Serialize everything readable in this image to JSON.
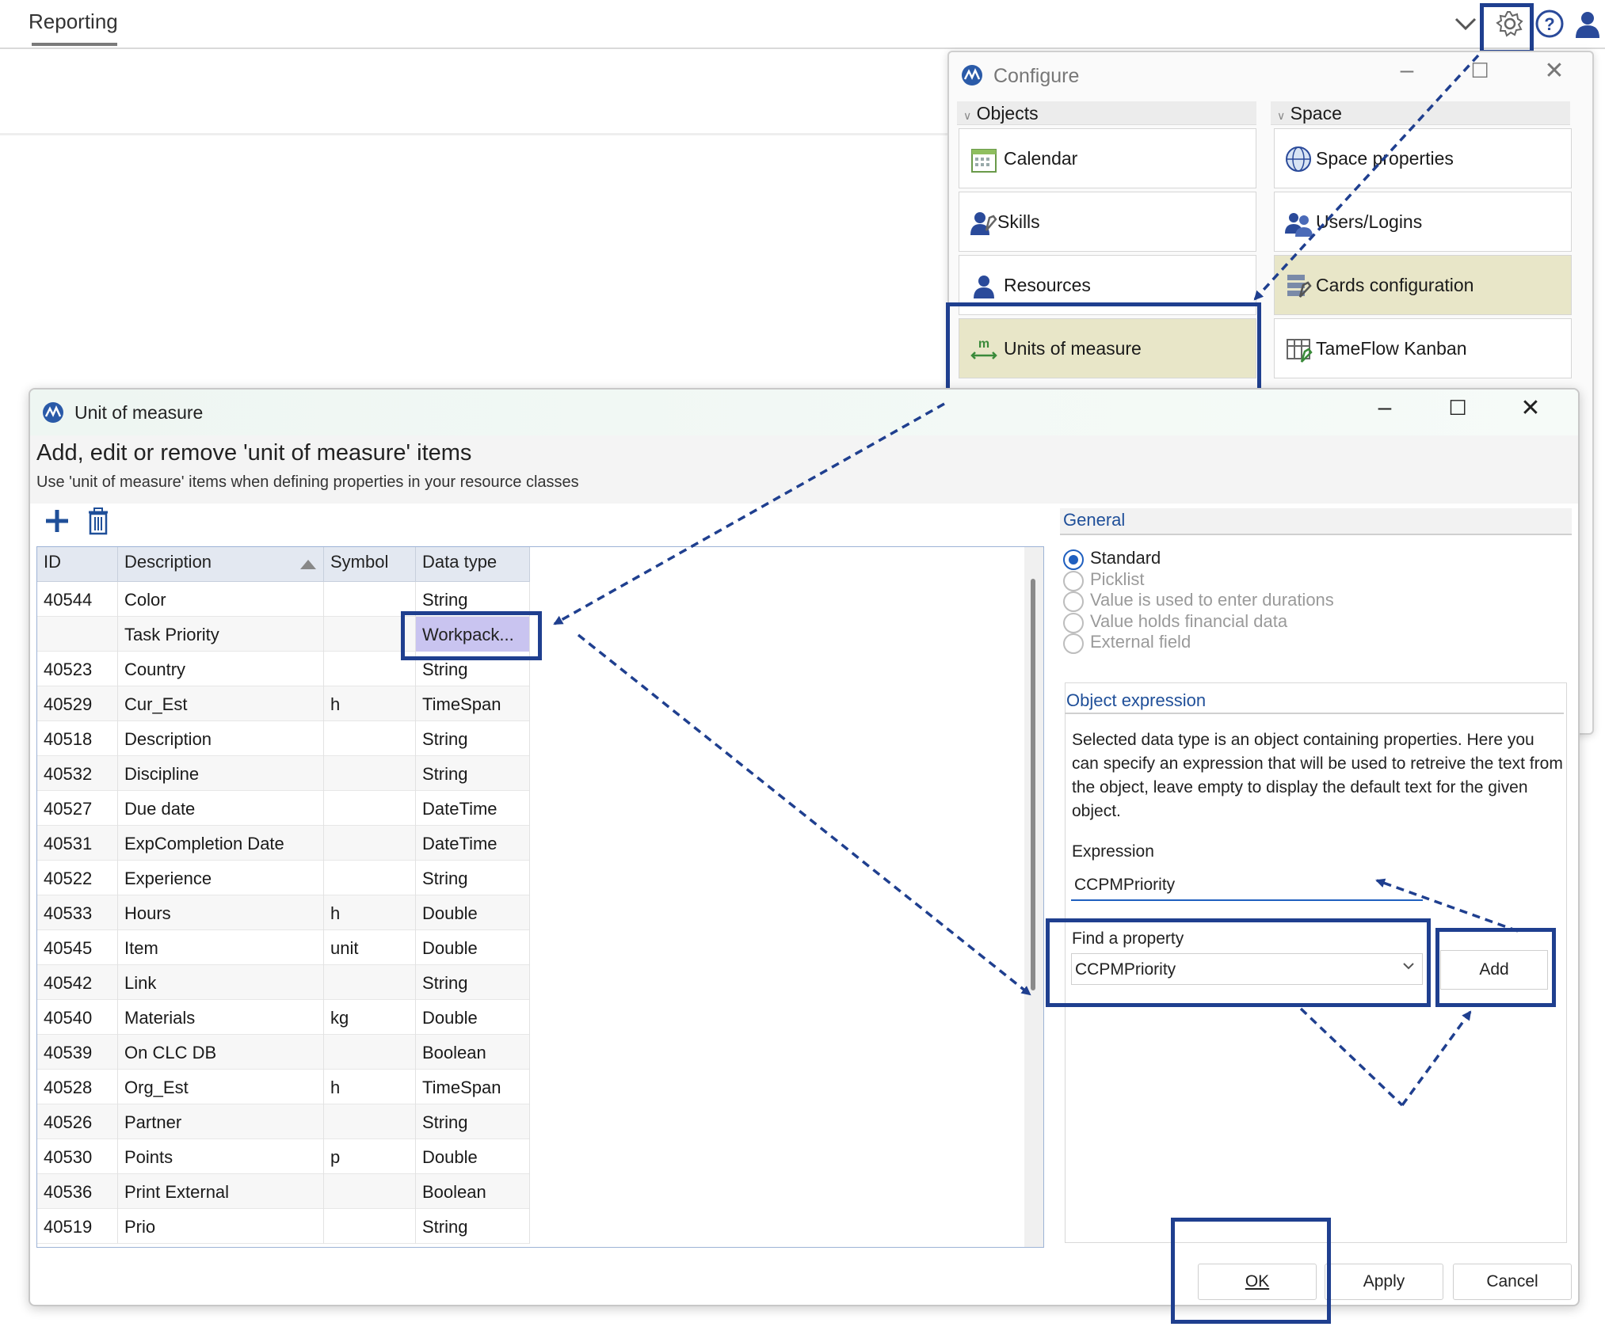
{
  "app": {
    "tab_label": "Reporting"
  },
  "configure": {
    "title": "Configure",
    "groups": [
      {
        "label": "Objects",
        "items": [
          "Calendar",
          "Skills",
          "Resources",
          "Units of measure"
        ]
      },
      {
        "label": "Space",
        "items": [
          "Space properties",
          "Users/Logins",
          "Cards configuration",
          "TameFlow Kanban"
        ]
      }
    ]
  },
  "uom": {
    "title": "Unit of measure",
    "heading": "Add, edit or remove 'unit of measure' items",
    "subheading": "Use 'unit of measure' items when defining properties in your resource classes",
    "columns": [
      "ID",
      "Description",
      "Symbol",
      "Data type"
    ],
    "rows": [
      {
        "id": "40544",
        "description": "Color",
        "symbol": "",
        "data_type": "String"
      },
      {
        "id": "",
        "description": "Task Priority",
        "symbol": "",
        "data_type": "Workpack..."
      },
      {
        "id": "40523",
        "description": "Country",
        "symbol": "",
        "data_type": "String"
      },
      {
        "id": "40529",
        "description": "Cur_Est",
        "symbol": "h",
        "data_type": "TimeSpan"
      },
      {
        "id": "40518",
        "description": "Description",
        "symbol": "",
        "data_type": "String"
      },
      {
        "id": "40532",
        "description": "Discipline",
        "symbol": "",
        "data_type": "String"
      },
      {
        "id": "40527",
        "description": "Due date",
        "symbol": "",
        "data_type": "DateTime"
      },
      {
        "id": "40531",
        "description": "ExpCompletion Date",
        "symbol": "",
        "data_type": "DateTime"
      },
      {
        "id": "40522",
        "description": "Experience",
        "symbol": "",
        "data_type": "String"
      },
      {
        "id": "40533",
        "description": "Hours",
        "symbol": "h",
        "data_type": "Double"
      },
      {
        "id": "40545",
        "description": "Item",
        "symbol": "unit",
        "data_type": "Double"
      },
      {
        "id": "40542",
        "description": "Link",
        "symbol": "",
        "data_type": "String"
      },
      {
        "id": "40540",
        "description": "Materials",
        "symbol": "kg",
        "data_type": "Double"
      },
      {
        "id": "40539",
        "description": "On CLC DB",
        "symbol": "",
        "data_type": "Boolean"
      },
      {
        "id": "40528",
        "description": "Org_Est",
        "symbol": "h",
        "data_type": "TimeSpan"
      },
      {
        "id": "40526",
        "description": "Partner",
        "symbol": "",
        "data_type": "String"
      },
      {
        "id": "40530",
        "description": "Points",
        "symbol": "p",
        "data_type": "Double"
      },
      {
        "id": "40536",
        "description": "Print External",
        "symbol": "",
        "data_type": "Boolean"
      },
      {
        "id": "40519",
        "description": "Prio",
        "symbol": "",
        "data_type": "String"
      }
    ],
    "general": {
      "title": "General",
      "options": [
        "Standard",
        "Picklist",
        "Value is used to enter durations",
        "Value holds financial data",
        "External field"
      ],
      "selected": "Standard"
    },
    "object_expression": {
      "title": "Object expression",
      "description": "Selected data type is an object containing properties. Here you can specify an expression that will be used to retreive the text from the object, leave empty to display the default text for the given object.",
      "expression_label": "Expression",
      "expression_value": "CCPMPriority",
      "find_label": "Find a property",
      "find_value": "CCPMPriority",
      "add_label": "Add"
    },
    "buttons": {
      "ok": "OK",
      "apply": "Apply",
      "cancel": "Cancel"
    }
  },
  "colors": {
    "highlight": "#1f3f8f",
    "selected_item": "#e8e6c8",
    "workpack_cell": "#c9c4f0",
    "accent": "#1f5fbf"
  },
  "icons": [
    "chevron-down-icon",
    "gear-icon",
    "help-icon",
    "user-icon",
    "app-logo-icon",
    "calendar-icon",
    "skills-icon",
    "resources-icon",
    "units-icon",
    "globe-icon",
    "users-icon",
    "cards-icon",
    "kanban-icon",
    "add-icon",
    "delete-icon",
    "minimize-icon",
    "maximize-icon",
    "close-icon"
  ]
}
